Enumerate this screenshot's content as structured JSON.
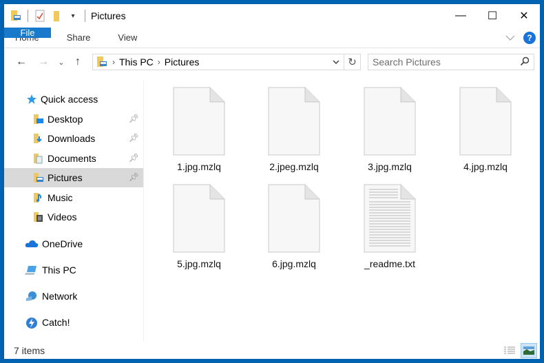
{
  "window": {
    "title": "Pictures",
    "controls": {
      "minimize": "—",
      "maximize": "☐",
      "close": "✕"
    }
  },
  "ribbon": {
    "tabs": [
      {
        "label": "File",
        "active": true
      },
      {
        "label": "Home"
      },
      {
        "label": "Share"
      },
      {
        "label": "View"
      }
    ],
    "help_label": "?",
    "expand_icon": "chevron-down-icon"
  },
  "navigation": {
    "back": "←",
    "forward": "→",
    "recent": "⌄",
    "up": "↑",
    "breadcrumb": [
      "This PC",
      "Pictures"
    ],
    "breadcrumb_sep": "›",
    "dropdown": "⌄",
    "refresh": "↻",
    "search_placeholder": "Search Pictures"
  },
  "sidebar": {
    "quick_access": {
      "label": "Quick access",
      "icon": "star-icon"
    },
    "pinned": [
      {
        "label": "Desktop",
        "icon": "desktop-folder-icon",
        "pinned": true
      },
      {
        "label": "Downloads",
        "icon": "downloads-folder-icon",
        "pinned": true
      },
      {
        "label": "Documents",
        "icon": "documents-folder-icon",
        "pinned": true
      },
      {
        "label": "Pictures",
        "icon": "pictures-folder-icon",
        "pinned": true,
        "selected": true
      },
      {
        "label": "Music",
        "icon": "music-folder-icon"
      },
      {
        "label": "Videos",
        "icon": "videos-folder-icon"
      }
    ],
    "locations": [
      {
        "label": "OneDrive",
        "icon": "onedrive-icon"
      },
      {
        "label": "This PC",
        "icon": "this-pc-icon"
      },
      {
        "label": "Network",
        "icon": "network-icon"
      },
      {
        "label": "Catch!",
        "icon": "catch-icon"
      }
    ]
  },
  "files": [
    {
      "name": "1.jpg.mzlq",
      "type": "blank"
    },
    {
      "name": "2.jpeg.mzlq",
      "type": "blank"
    },
    {
      "name": "3.jpg.mzlq",
      "type": "blank"
    },
    {
      "name": "4.jpg.mzlq",
      "type": "blank"
    },
    {
      "name": "5.jpg.mzlq",
      "type": "blank"
    },
    {
      "name": "6.jpg.mzlq",
      "type": "blank"
    },
    {
      "name": "_readme.txt",
      "type": "text"
    }
  ],
  "status": {
    "item_count": "7 items",
    "views": [
      "details",
      "large-icons"
    ],
    "active_view": "large-icons"
  }
}
